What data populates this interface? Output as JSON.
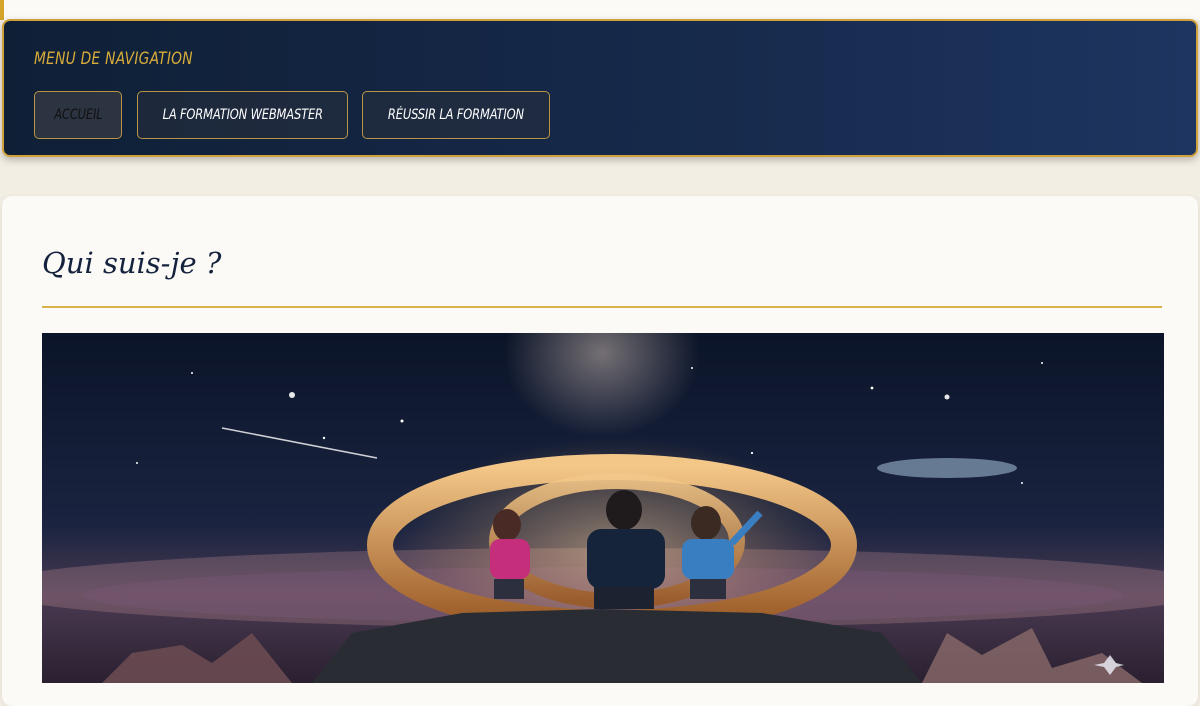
{
  "nav": {
    "title": "MENU DE NAVIGATION",
    "items": [
      {
        "label": "ACCUEIL",
        "active": true
      },
      {
        "label": "LA FORMATION WEBMASTER",
        "active": false
      },
      {
        "label": "RÉUSSIR LA FORMATION",
        "active": false
      }
    ]
  },
  "main": {
    "heading": "Qui suis-je ?",
    "hero_image": {
      "icon": "at-sign-icon",
      "subject": "family-silhouette"
    }
  },
  "colors": {
    "accent_gold": "#d4a52a",
    "nav_bg": "#16294a",
    "heading": "#15223d"
  }
}
